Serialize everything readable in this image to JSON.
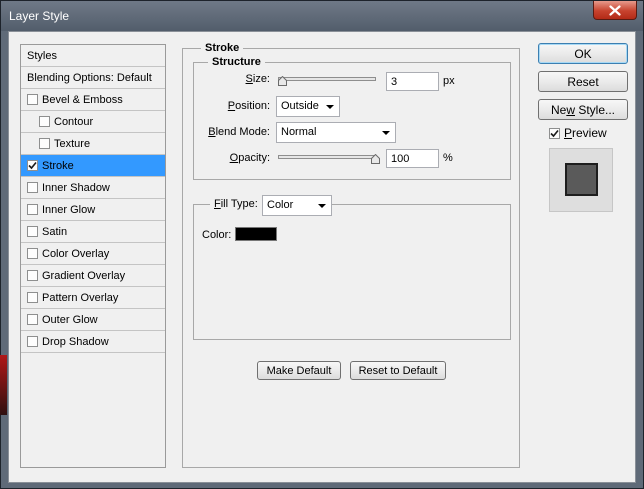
{
  "window": {
    "title": "Layer Style"
  },
  "sidebar": {
    "header": "Styles",
    "blending": "Blending Options: Default",
    "items": [
      {
        "label": "Bevel & Emboss",
        "checked": false,
        "sub": false,
        "selected": false
      },
      {
        "label": "Contour",
        "checked": false,
        "sub": true,
        "selected": false
      },
      {
        "label": "Texture",
        "checked": false,
        "sub": true,
        "selected": false
      },
      {
        "label": "Stroke",
        "checked": true,
        "sub": false,
        "selected": true
      },
      {
        "label": "Inner Shadow",
        "checked": false,
        "sub": false,
        "selected": false
      },
      {
        "label": "Inner Glow",
        "checked": false,
        "sub": false,
        "selected": false
      },
      {
        "label": "Satin",
        "checked": false,
        "sub": false,
        "selected": false
      },
      {
        "label": "Color Overlay",
        "checked": false,
        "sub": false,
        "selected": false
      },
      {
        "label": "Gradient Overlay",
        "checked": false,
        "sub": false,
        "selected": false
      },
      {
        "label": "Pattern Overlay",
        "checked": false,
        "sub": false,
        "selected": false
      },
      {
        "label": "Outer Glow",
        "checked": false,
        "sub": false,
        "selected": false
      },
      {
        "label": "Drop Shadow",
        "checked": false,
        "sub": false,
        "selected": false
      }
    ]
  },
  "stroke": {
    "title": "Stroke",
    "structure": {
      "title": "Structure",
      "size": {
        "label": "Size:",
        "value": "3",
        "unit": "px",
        "slider_level": 0.02
      },
      "position": {
        "label": "Position:",
        "value": "Outside"
      },
      "blend_mode": {
        "label": "Blend Mode:",
        "value": "Normal"
      },
      "opacity": {
        "label": "Opacity:",
        "value": "100",
        "unit": "%",
        "slider_level": 1.0
      }
    },
    "fill": {
      "type_label": "Fill Type:",
      "type_value": "Color",
      "color_label": "Color:",
      "color": "#000000"
    },
    "make_default": "Make Default",
    "reset_default": "Reset to Default"
  },
  "actions": {
    "ok": "OK",
    "reset": "Reset",
    "new_style": "New Style...",
    "preview_label": "Preview",
    "preview_checked": true
  },
  "colors": {
    "selection": "#3399ff",
    "titlebar": "#5f6a78",
    "close": "#c7432e",
    "preview_fill": "#5a5a5a"
  }
}
